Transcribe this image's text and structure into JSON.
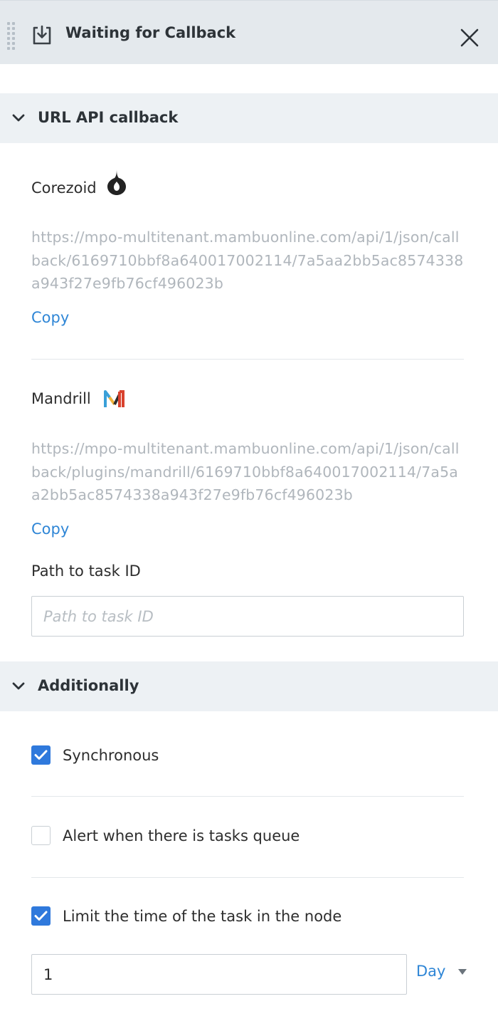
{
  "header": {
    "title": "Waiting for Callback"
  },
  "sections": {
    "url_api": {
      "title": "URL API callback"
    },
    "additionally": {
      "title": "Additionally"
    }
  },
  "corezoid": {
    "label": "Corezoid",
    "url": "https://mpo-multitenant.mambuonline.com/api/1/json/callback/6169710bbf8a640017002114/7a5aa2bb5ac8574338a943f27e9fb76cf496023b",
    "copy_label": "Copy"
  },
  "mandrill": {
    "label": "Mandrill",
    "url": "https://mpo-multitenant.mambuonline.com/api/1/json/callback/plugins/mandrill/6169710bbf8a640017002114/7a5aa2bb5ac8574338a943f27e9fb76cf496023b",
    "copy_label": "Copy"
  },
  "path_to_task": {
    "label": "Path to task ID",
    "placeholder": "Path to task ID",
    "value": ""
  },
  "options": {
    "synchronous": {
      "label": "Synchronous",
      "checked": true
    },
    "alert_queue": {
      "label": "Alert when there is tasks queue",
      "checked": false
    },
    "limit_time": {
      "label": "Limit the time of the task in the node",
      "checked": true
    }
  },
  "time_limit": {
    "value": "1",
    "unit": "Day"
  },
  "colors": {
    "accent": "#2f86d6",
    "checkbox": "#2f79dc",
    "header_bg": "#e4e9ed",
    "section_bg": "#edf1f4"
  }
}
